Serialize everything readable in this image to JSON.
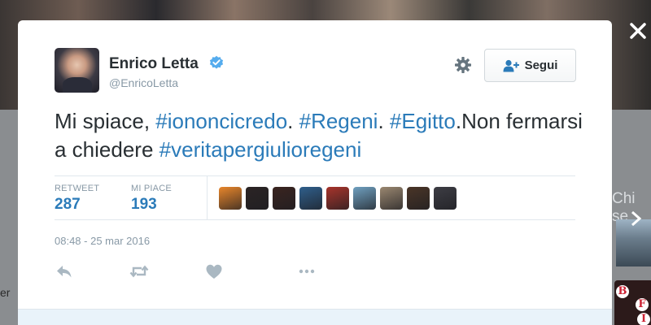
{
  "background": {
    "side_text": "Chi se",
    "left_text": "er",
    "side_logo_letters": [
      "B",
      "F",
      "I"
    ]
  },
  "tweet": {
    "author_name": "Enrico Letta",
    "author_handle": "@EnricoLetta",
    "verified": true,
    "follow_label": "Segui",
    "text_segments": [
      {
        "text": "Mi spiace, ",
        "type": "plain"
      },
      {
        "text": "#iononcicredo",
        "type": "hashtag"
      },
      {
        "text": ". ",
        "type": "plain"
      },
      {
        "text": "#Regeni",
        "type": "hashtag"
      },
      {
        "text": ". ",
        "type": "plain"
      },
      {
        "text": "#Egitto",
        "type": "hashtag"
      },
      {
        "text": ".Non fermarsi a chiedere ",
        "type": "plain"
      },
      {
        "text": "#veritapergiulioregeni",
        "type": "hashtag"
      }
    ],
    "stats": {
      "retweet_label": "RETWEET",
      "retweet_count": "287",
      "likes_label": "MI PIACE",
      "likes_count": "193"
    },
    "liker_avatar_colors": [
      "#e8862b",
      "#2b2424",
      "#3a2420",
      "#2f5f8c",
      "#a8342b",
      "#6fa0c0",
      "#9a8770",
      "#4a3527",
      "#3d3d44"
    ],
    "timestamp": "08:48 - 25 mar 2016",
    "actions": [
      "reply-icon",
      "retweet-icon",
      "like-icon",
      "more-icon"
    ]
  },
  "colors": {
    "link": "#2b7bb9",
    "text": "#292f33",
    "muted": "#8899a6",
    "verified": "#55acee"
  }
}
